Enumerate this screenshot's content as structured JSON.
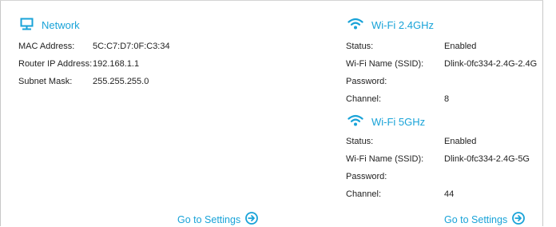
{
  "network": {
    "title": "Network",
    "icon": "monitor-network-icon",
    "rows": [
      {
        "label": "MAC Address:",
        "value": "5C:C7:D7:0F:C3:34"
      },
      {
        "label": "Router IP Address:",
        "value": "192.168.1.1"
      },
      {
        "label": "Subnet Mask:",
        "value": "255.255.255.0"
      }
    ],
    "settings_label": "Go to Settings"
  },
  "wifi24": {
    "title": "Wi-Fi 2.4GHz",
    "icon": "wifi-icon",
    "rows": [
      {
        "label": "Status:",
        "value": "Enabled"
      },
      {
        "label": "Wi-Fi Name (SSID):",
        "value": "Dlink-0fc334-2.4G-2.4G"
      },
      {
        "label": "Password:",
        "value": ""
      },
      {
        "label": "Channel:",
        "value": "8"
      }
    ]
  },
  "wifi5": {
    "title": "Wi-Fi 5GHz",
    "icon": "wifi-icon",
    "rows": [
      {
        "label": "Status:",
        "value": "Enabled"
      },
      {
        "label": "Wi-Fi Name (SSID):",
        "value": "Dlink-0fc334-2.4G-5G"
      },
      {
        "label": "Password:",
        "value": ""
      },
      {
        "label": "Channel:",
        "value": "44"
      }
    ],
    "settings_label": "Go to Settings"
  },
  "colors": {
    "accent": "#19a3d8",
    "text": "#222222",
    "border": "#c8c8c8"
  }
}
